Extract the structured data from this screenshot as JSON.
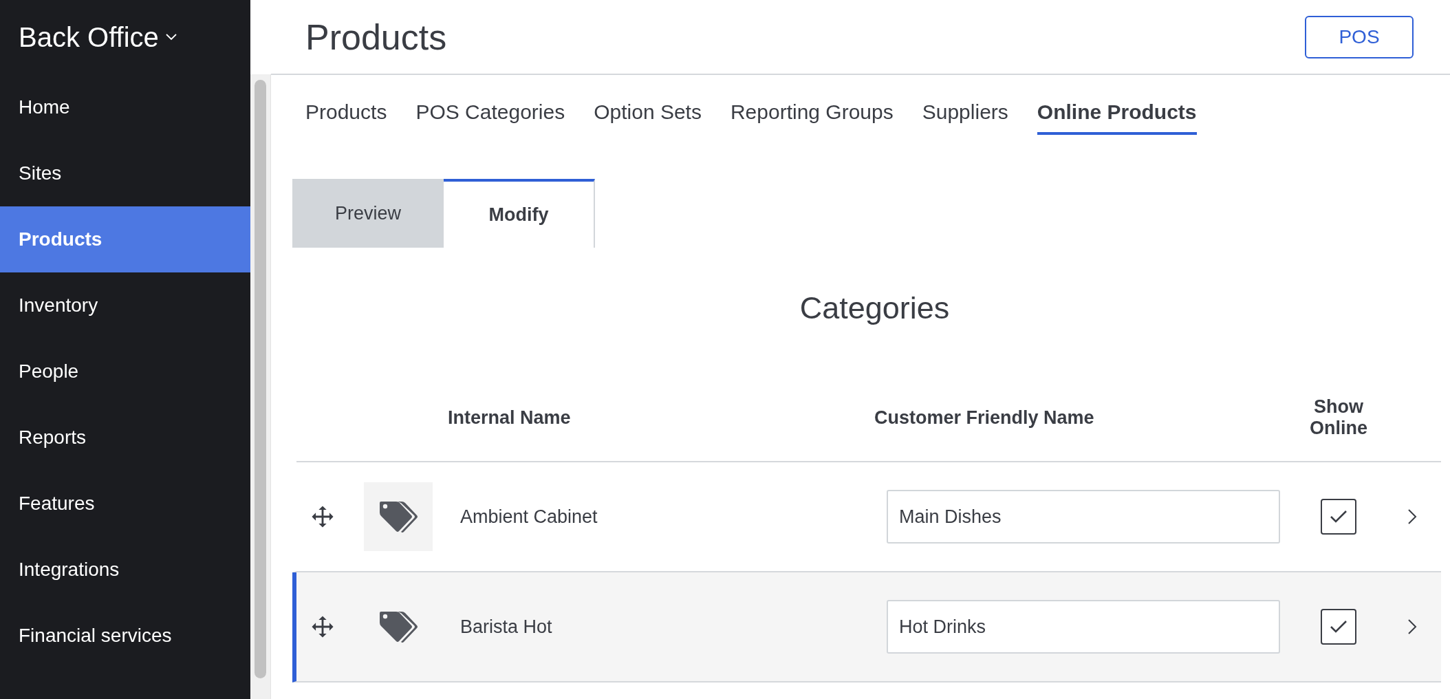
{
  "sidebar": {
    "title": "Back Office",
    "items": [
      {
        "label": "Home",
        "selected": false
      },
      {
        "label": "Sites",
        "selected": false
      },
      {
        "label": "Products",
        "selected": true
      },
      {
        "label": "Inventory",
        "selected": false
      },
      {
        "label": "People",
        "selected": false
      },
      {
        "label": "Reports",
        "selected": false
      },
      {
        "label": "Features",
        "selected": false
      },
      {
        "label": "Integrations",
        "selected": false
      },
      {
        "label": "Financial services",
        "selected": false
      }
    ]
  },
  "header": {
    "title": "Products",
    "button": "POS"
  },
  "tabs": [
    {
      "label": "Products",
      "selected": false
    },
    {
      "label": "POS Categories",
      "selected": false
    },
    {
      "label": "Option Sets",
      "selected": false
    },
    {
      "label": "Reporting Groups",
      "selected": false
    },
    {
      "label": "Suppliers",
      "selected": false
    },
    {
      "label": "Online Products",
      "selected": true
    }
  ],
  "mode_tabs": [
    {
      "label": "Preview",
      "selected": false
    },
    {
      "label": "Modify",
      "selected": true
    }
  ],
  "section_title": "Categories",
  "table": {
    "columns": [
      "Internal Name",
      "Customer Friendly Name",
      "Show Online"
    ],
    "rows": [
      {
        "internal_name": "Ambient Cabinet",
        "customer_name": "Main Dishes",
        "show_online": true,
        "selected": false
      },
      {
        "internal_name": "Barista Hot",
        "customer_name": "Hot Drinks",
        "show_online": true,
        "selected": true
      }
    ]
  }
}
